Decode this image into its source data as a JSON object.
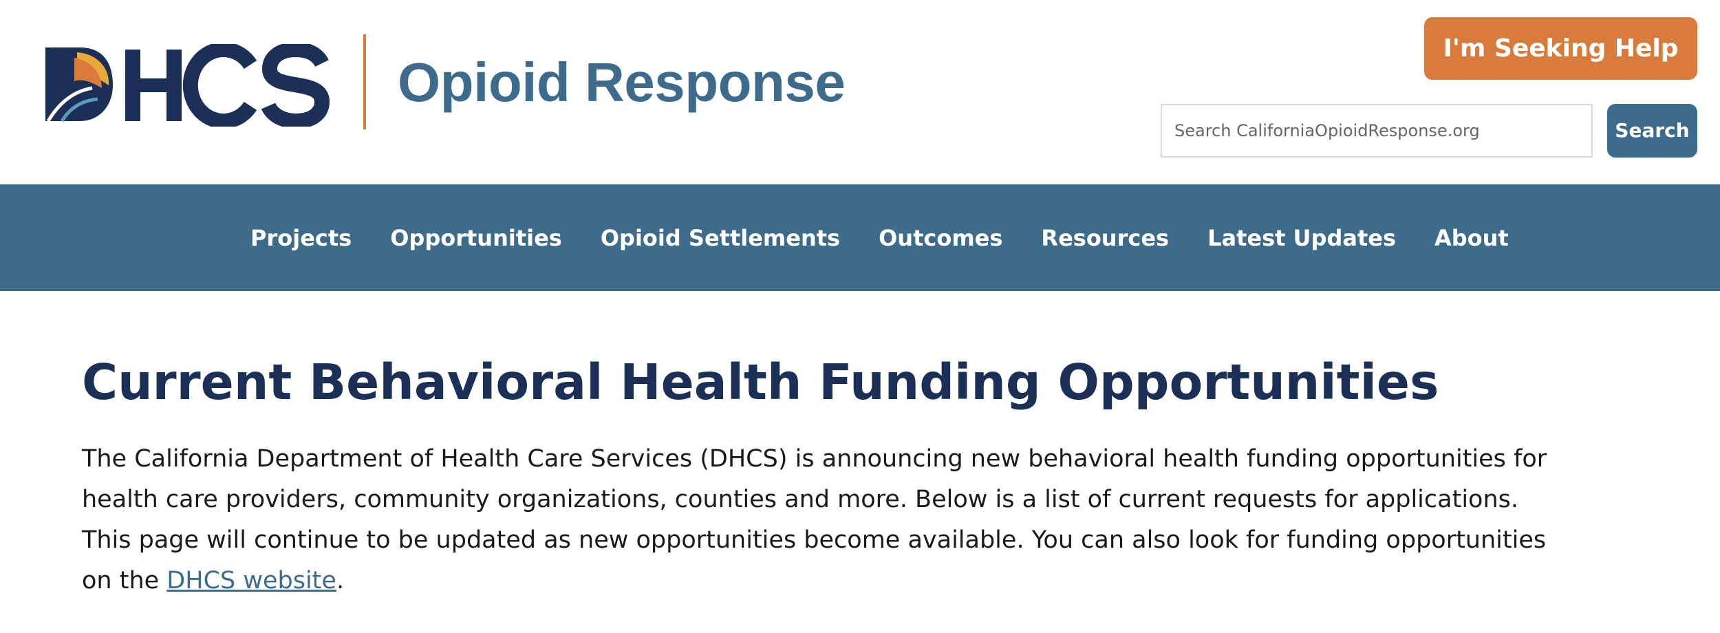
{
  "header": {
    "logo_text": "DHCS",
    "site_name": "Opioid Response",
    "seeking_help_label": "I'm Seeking Help",
    "search": {
      "placeholder": "Search CaliforniaOpioidResponse.org",
      "value": "",
      "button_label": "Search"
    }
  },
  "nav": {
    "items": [
      {
        "label": "Projects"
      },
      {
        "label": "Opportunities"
      },
      {
        "label": "Opioid Settlements"
      },
      {
        "label": "Outcomes"
      },
      {
        "label": "Resources"
      },
      {
        "label": "Latest Updates"
      },
      {
        "label": "About"
      }
    ]
  },
  "main": {
    "title": "Current Behavioral Health Funding Opportunities",
    "intro_text": "The California Department of Health Care Services (DHCS) is announcing new behavioral health funding opportunities for health care providers, community organizations, counties and more. Below is a list of current requests for applications. This page will continue to be updated as new opportunities become available. You can also look for funding opportunities on the ",
    "intro_link": "DHCS website",
    "intro_end": "."
  },
  "colors": {
    "navy": "#1c2f57",
    "steel_blue": "#3d6b8c",
    "orange": "#d97c3b",
    "gold": "#e8a83a"
  },
  "icons": [
    "dhcs-logo-icon"
  ]
}
